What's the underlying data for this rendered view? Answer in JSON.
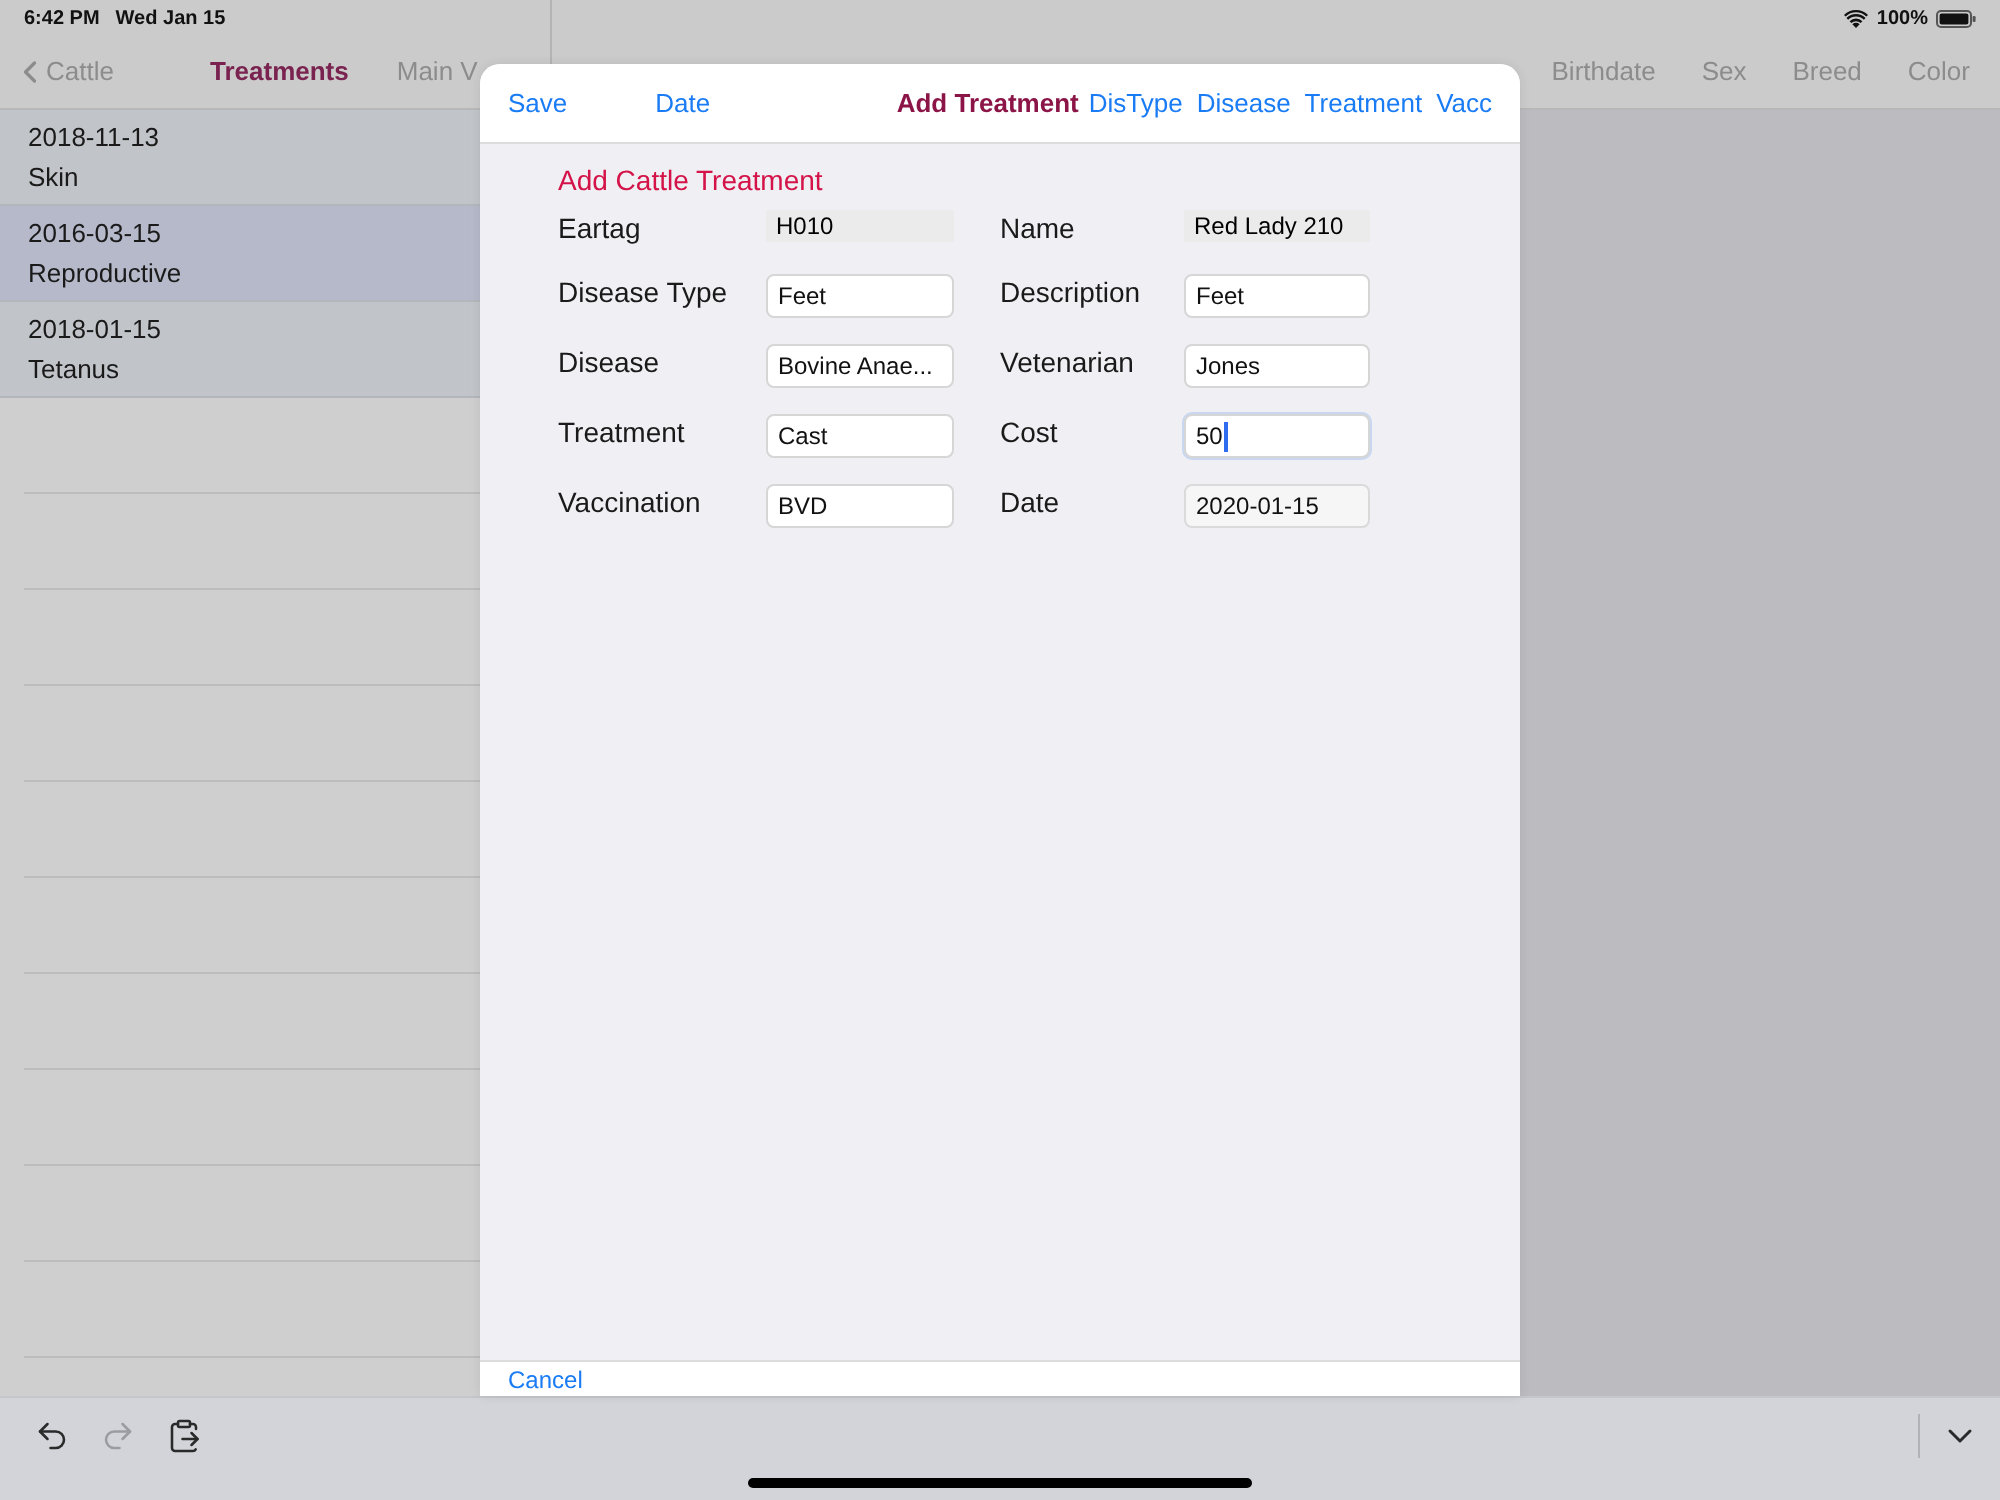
{
  "status_bar": {
    "time": "6:42 PM",
    "date": "Wed Jan 15",
    "battery": "100%"
  },
  "nav": {
    "back": "Cattle",
    "title": "Treatments",
    "buttons": [
      "Main V"
    ],
    "columns": [
      "Birthdate",
      "Sex",
      "Breed",
      "Color"
    ]
  },
  "list": {
    "rows": [
      {
        "date": "2018-11-13",
        "type": "Skin",
        "selected": false
      },
      {
        "date": "2016-03-15",
        "type": "Reproductive",
        "selected": true
      },
      {
        "date": "2018-01-15",
        "type": "Tetanus",
        "selected": false
      }
    ]
  },
  "modal": {
    "header": {
      "left": [
        "Save",
        "Date"
      ],
      "title": "Add Treatment",
      "right": [
        "DisType",
        "Disease",
        "Treatment",
        "Vacc"
      ]
    },
    "title": "Add Cattle Treatment",
    "fields": [
      {
        "label": "Eartag",
        "value": "H010",
        "kind": "readonly",
        "focused": false
      },
      {
        "label": "Name",
        "value": "Red Lady 210",
        "kind": "readonly",
        "focused": false
      },
      {
        "label": "Disease Type",
        "value": "Feet",
        "kind": "text",
        "focused": false
      },
      {
        "label": "Description",
        "value": "Feet",
        "kind": "text",
        "focused": false
      },
      {
        "label": "Disease",
        "value": "Bovine Anae...",
        "kind": "text",
        "focused": false
      },
      {
        "label": "Vetenarian",
        "value": "Jones",
        "kind": "text",
        "focused": false
      },
      {
        "label": "Treatment",
        "value": "Cast",
        "kind": "text",
        "focused": false
      },
      {
        "label": "Cost",
        "value": "50",
        "kind": "text",
        "focused": true
      },
      {
        "label": "Vaccination",
        "value": "BVD",
        "kind": "text",
        "focused": false
      },
      {
        "label": "Date",
        "value": "2020-01-15",
        "kind": "date",
        "focused": false
      }
    ],
    "cancel": "Cancel"
  },
  "keyboard_bar": {
    "items": [
      {
        "kind": "undo",
        "disabled": false
      },
      {
        "kind": "redo",
        "disabled": true
      },
      {
        "kind": "paste",
        "disabled": false
      }
    ]
  }
}
